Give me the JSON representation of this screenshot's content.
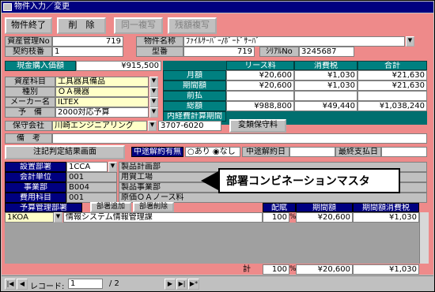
{
  "window": {
    "title": "物件入力／変更"
  },
  "toolbar": {
    "finish": "物件終了",
    "delete": "削　除",
    "copy_same": "同一複写",
    "copy_rest": "残額複写"
  },
  "left": {
    "asset_no_label": "資産管理No",
    "asset_no": "719",
    "contract_label": "契約枝番",
    "contract": "1",
    "cash_label": "現金購入価額",
    "cash": "¥915,500",
    "category_label": "資産科目",
    "category": "工具器具備品",
    "type_label": "種別",
    "type": "ＯＡ機器",
    "maker_label": "メーカー名",
    "maker": "ILTEX",
    "budget_label": "予　備",
    "budget": "2000対応予算",
    "company_label": "保守会社",
    "company": "川崎エンジニアリング",
    "company_tel": "3707-6020",
    "change_btn": "変類保守料",
    "note_label": "備　考",
    "judge_btn": "注記判定結果画面"
  },
  "right": {
    "name_label": "物件名称",
    "name": "ﾌｧｲﾙｻｰﾊﾞｰ/ﾎﾞｰﾄﾞｻｰﾊﾞ",
    "model_label": "型番",
    "model": "719",
    "serial_label": "ｼﾘｱﾙNo",
    "serial": "3245687"
  },
  "finance": {
    "headers": [
      "リース料",
      "消費税",
      "合計"
    ],
    "rows": [
      {
        "label": "月額",
        "v": [
          "¥20,600",
          "¥1,030",
          "¥21,630"
        ]
      },
      {
        "label": "期間額",
        "v": [
          "¥20,600",
          "¥1,030",
          "¥21,630"
        ]
      },
      {
        "label": "前払",
        "v": [
          "",
          "",
          ""
        ]
      },
      {
        "label": "総額",
        "v": [
          "¥988,800",
          "¥49,440",
          "¥1,038,240"
        ]
      },
      {
        "label": "内経費計算期間",
        "v": [
          "",
          "",
          ""
        ]
      }
    ]
  },
  "cancel": {
    "label": "中途解約有無",
    "opt_yes": "あり",
    "opt_no": "なし",
    "date_label": "中途解約日",
    "last_label": "最終支払日"
  },
  "dept": {
    "rows": [
      {
        "label": "設置部署",
        "code": "1CCA",
        "name": "製品計画部"
      },
      {
        "label": "会計単位",
        "code": "001",
        "name": "用賀工場"
      },
      {
        "label": "事業部",
        "code": "B004",
        "name": "製品事業部"
      },
      {
        "label": "費用科目",
        "code": "001",
        "name": "原価ＯＡノース料"
      }
    ]
  },
  "callout": "部署コンビネーションマスタ",
  "budget_table": {
    "header": "予算管理部署",
    "add": "部署追加",
    "del": "部署削除",
    "cols": [
      "配賦",
      "期間額",
      "期間額消費税"
    ],
    "rows": [
      {
        "code": "1KOA",
        "name": "情報システム情報管理課",
        "ratio": "100",
        "pct": "%",
        "amt": "¥20,600",
        "tax": "¥1,030"
      }
    ],
    "total_label": "計",
    "total_ratio": "100",
    "total_amt": "¥20,600",
    "total_tax": "¥1,030"
  },
  "status": {
    "record_label": "レコード:",
    "record": "1",
    "of": "/ 2"
  }
}
